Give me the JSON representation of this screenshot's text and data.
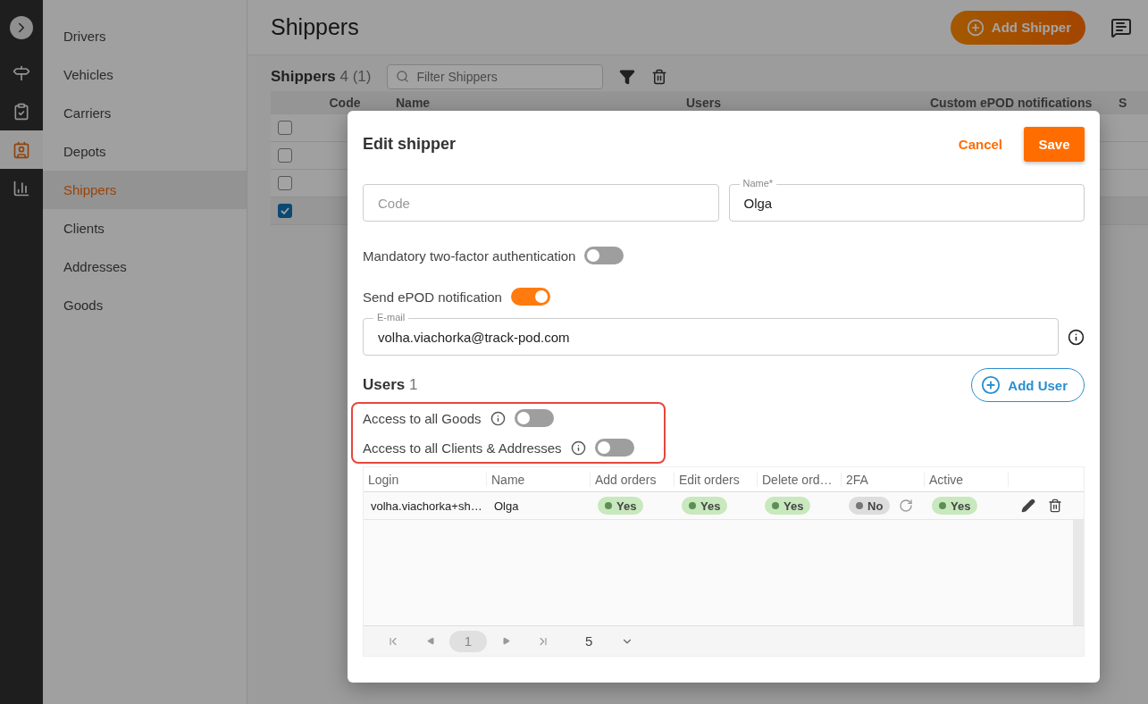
{
  "rail": {
    "items": [
      {
        "kind": "route",
        "selected": false
      },
      {
        "kind": "checklist",
        "selected": false
      },
      {
        "kind": "badge",
        "selected": true
      },
      {
        "kind": "chart",
        "selected": false
      }
    ]
  },
  "sidebar": {
    "items": [
      {
        "label": "Drivers",
        "selected": false
      },
      {
        "label": "Vehicles",
        "selected": false
      },
      {
        "label": "Carriers",
        "selected": false
      },
      {
        "label": "Depots",
        "selected": false
      },
      {
        "label": "Shippers",
        "selected": true
      },
      {
        "label": "Clients",
        "selected": false
      },
      {
        "label": "Addresses",
        "selected": false
      },
      {
        "label": "Goods",
        "selected": false
      }
    ]
  },
  "page": {
    "title": "Shippers",
    "add_button": "Add Shipper"
  },
  "list": {
    "title": "Shippers",
    "count": "4 (1)",
    "filter_placeholder": "Filter Shippers",
    "columns": [
      "Code",
      "Name",
      "Users",
      "Custom ePOD notifications",
      "S"
    ],
    "rows": [
      {
        "checked": false
      },
      {
        "checked": false
      },
      {
        "checked": false
      },
      {
        "checked": true
      }
    ]
  },
  "dialog": {
    "title": "Edit shipper",
    "cancel": "Cancel",
    "save": "Save",
    "code": {
      "placeholder": "Code"
    },
    "name": {
      "label": "Name*",
      "value": "Olga"
    },
    "two_factor": {
      "label": "Mandatory two-factor authentication",
      "on": false
    },
    "epod": {
      "label": "Send ePOD notification",
      "on": true
    },
    "email": {
      "label": "E-mail",
      "value": "volha.viachorka@track-pod.com"
    },
    "users_title": "Users",
    "users_count": "1",
    "add_user": "Add User",
    "access": [
      {
        "label": "Access to all Goods",
        "on": false
      },
      {
        "label": "Access to all Clients & Addresses",
        "on": false
      }
    ],
    "table": {
      "columns": [
        "Login",
        "Name",
        "Add orders",
        "Edit orders",
        "Delete ord…",
        "2FA",
        "Active"
      ],
      "rows": [
        {
          "login": "volha.viachorka+sh…",
          "name": "Olga",
          "add_orders": {
            "text": "Yes",
            "on": true
          },
          "edit_orders": {
            "text": "Yes",
            "on": true
          },
          "delete_orders": {
            "text": "Yes",
            "on": true
          },
          "two_fa": {
            "text": "No",
            "on": false
          },
          "active": {
            "text": "Yes",
            "on": true
          }
        }
      ]
    },
    "pager": {
      "pages": [
        {
          "label": "1",
          "selected": true
        }
      ],
      "page_size": "5"
    }
  }
}
